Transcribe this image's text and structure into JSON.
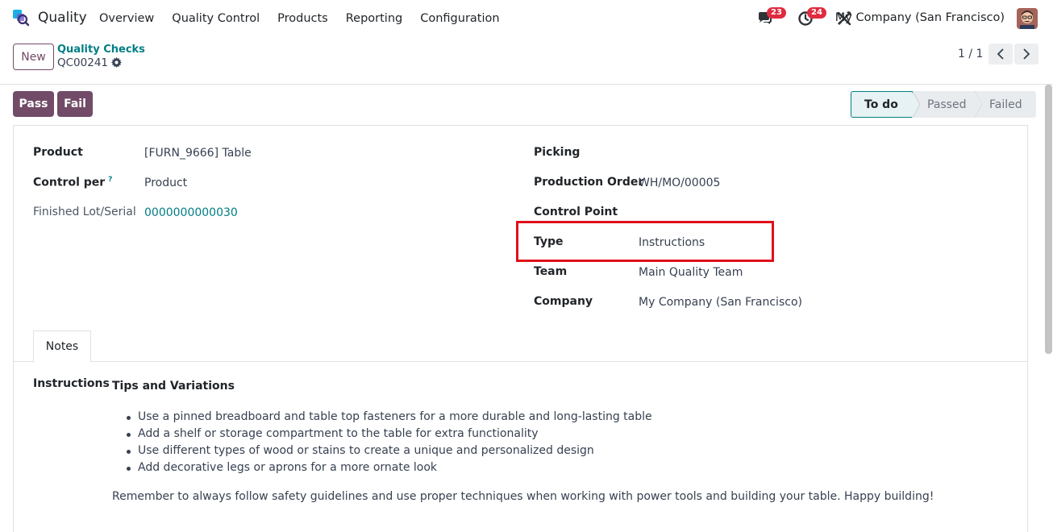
{
  "nav": {
    "app_name": "Quality",
    "menu": [
      "Overview",
      "Quality Control",
      "Products",
      "Reporting",
      "Configuration"
    ],
    "messages_count": "23",
    "activities_count": "24",
    "company": "My Company (San Francisco)"
  },
  "control": {
    "new_label": "New",
    "breadcrumb_parent": "Quality Checks",
    "breadcrumb_current": "QC00241",
    "pager": "1 / 1"
  },
  "actions": {
    "pass_label": "Pass",
    "fail_label": "Fail"
  },
  "stages": {
    "todo": "To do",
    "passed": "Passed",
    "failed": "Failed",
    "active": "To do"
  },
  "left_fields": {
    "product_label": "Product",
    "product_value": "[FURN_9666] Table",
    "control_per_label": "Control per",
    "control_per_help": "?",
    "control_per_value": "Product",
    "lot_label": "Finished Lot/Serial",
    "lot_value": "0000000000030"
  },
  "right_fields": {
    "picking_label": "Picking",
    "production_order_label": "Production Order",
    "production_order_value": "WH/MO/00005",
    "control_point_label": "Control Point",
    "type_label": "Type",
    "type_value": "Instructions",
    "team_label": "Team",
    "team_value": "Main Quality Team",
    "company_label": "Company",
    "company_value": "My Company (San Francisco)"
  },
  "notes": {
    "tab_label": "Notes",
    "instructions_label": "Instructions",
    "heading": "Tips and Variations",
    "bullets": [
      "Use a pinned breadboard and table top fasteners for a more durable and long-lasting table",
      "Add a shelf or storage compartment to the table for extra functionality",
      "Use different types of wood or stains to create a unique and personalized design",
      "Add decorative legs or aprons for a more ornate look"
    ],
    "closing": "Remember to always follow safety guidelines and use proper techniques when working with power tools and building your table. Happy building!"
  },
  "colors": {
    "brand": "#714b67",
    "link": "#017e84",
    "highlight": "#e0101b",
    "badge": "#e02a3e"
  },
  "icons": [
    "quality-app-icon",
    "chat-icon",
    "activity-clock-icon",
    "tools-icon",
    "gear-icon",
    "chevron-left-icon",
    "chevron-right-icon"
  ]
}
